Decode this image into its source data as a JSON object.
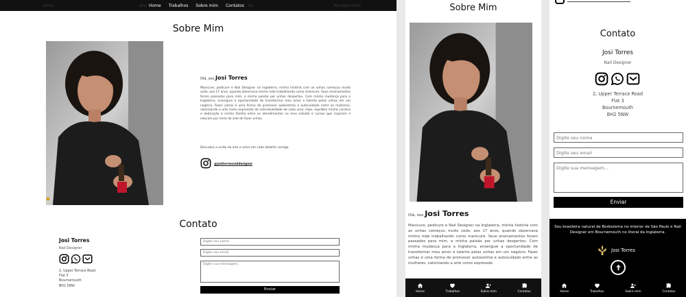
{
  "nav": {
    "items": [
      "Home",
      "Trabalhos",
      "Sobre mim",
      "Contatos"
    ],
    "faint_left": "Início",
    "faint_mid_left": "Ano",
    "faint_mid_right": "ito",
    "faint_right": "Alongamento"
  },
  "about": {
    "title": "Sobre Mim",
    "greeting_prefix": "Olá, sou",
    "name": "Josi Torres",
    "bio": "Manicure, pedicure e Nail Designer na Inglaterra, minha história com as unhas começou muito cedo, aos 17 anos, quando observava minha mãe trabalhando como manicure. Seus ensinamentos foram passados para mim, e minha paixão por unhas despertou. Com minha mudança para a Inglaterra, enxerguei a oportunidade de transformar meu amor e talento pelas unhas em um negócio. Fazer unhas é uma forma de promover autoestima e autocuidado entre as mulheres, valorizando a arte como expressão de individualidade de cada uma. Hoje, equilibro minha carreira e dedicação à minha família entre os atendimentos no meu estúdio e cursos que inspiram e educam por meio da arte de fazer unhas.",
    "bio_closing": "Descubra a união da arte e amor em cada detalhe comigo.",
    "instagram_handle": "@jositorresnaildesigner"
  },
  "contact": {
    "title": "Contato",
    "name": "Josi Torres",
    "role": "Nail Designer",
    "address": [
      "2, Upper Terrace Road",
      "Flat 3",
      "Bournemouth",
      "BH2 5NW"
    ],
    "placeholder_name": "Digite seu nome",
    "placeholder_email": "Digite seu email",
    "placeholder_message": "Digite sua mensagem...",
    "send_label": "Enviar"
  },
  "mobile": {
    "about_title": "Sobre Mim",
    "greeting_prefix": "Olá, sou",
    "name": "Josi Torres",
    "bio_visible": "Manicure, pedicure e Nail Designer na Inglaterra, minha história com as unhas começou muito cedo, aos 17 anos, quando observava minha mãe trabalhando como manicure. Seus ensinamentos foram passados para mim, e minha paixão por unhas despertou. Com minha mudança para a Inglaterra, enxerguei a oportunidade de transformar meu amor e talento pelas unhas em um negócio. Fazer unhas é uma forma de promover autoestima e autocuidado entre as mulheres, valorizando a arte como expressão"
  },
  "footer": {
    "text": "Sou brasileira natural de Borborema no interior de São Paulo e Nail Designer em Bournemouth no litoral da Inglaterra.",
    "brand": "Josi Torres"
  },
  "colors": {
    "nav_bg": "#111111",
    "button_bg": "#000000",
    "page_bg": "#ffffff"
  },
  "icons": [
    "instagram-icon",
    "whatsapp-icon",
    "mail-icon",
    "home-icon",
    "heart-icon",
    "users-icon",
    "puzzle-icon",
    "arrow-up-icon",
    "fleur-de-lis-icon"
  ]
}
